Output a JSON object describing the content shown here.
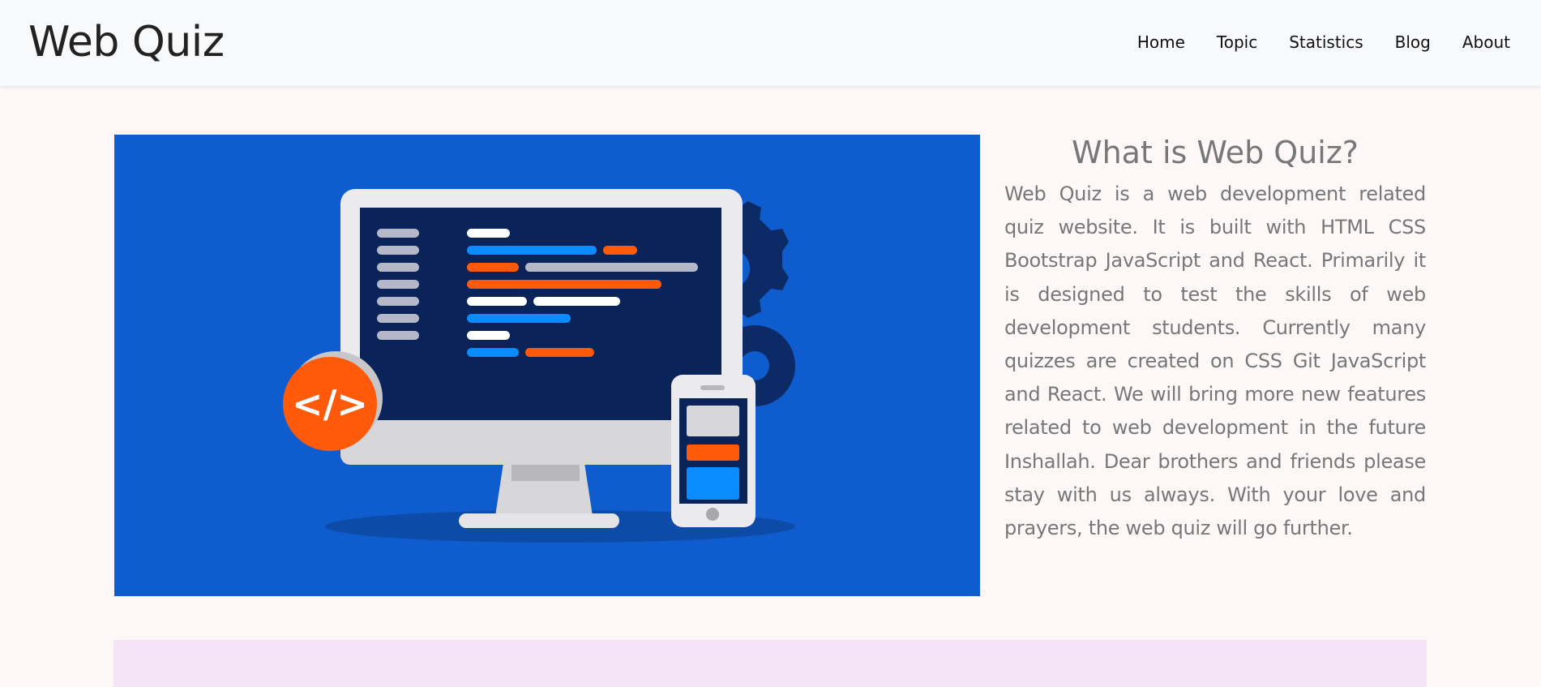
{
  "navbar": {
    "brand": "Web Quiz",
    "links": [
      {
        "label": "Home"
      },
      {
        "label": "Topic"
      },
      {
        "label": "Statistics"
      },
      {
        "label": "Blog"
      },
      {
        "label": "About"
      }
    ]
  },
  "hero": {
    "illustration": "web-development-monitor-illustration",
    "code_badge": "</>",
    "background_color": "#0f5cce"
  },
  "about": {
    "title": "What is Web Quiz?",
    "text": "Web Quiz is a web development related quiz website. It is built with HTML CSS Bootstrap JavaScript and React. Primarily it is designed to test the skills of web development students. Currently many quizzes are created on CSS Git JavaScript and React. We will bring more new features related to web development in the future Inshallah. Dear brothers and friends please stay with us always. With your love and prayers, the web quiz will go further."
  },
  "colors": {
    "accent_orange": "#ff5a0a",
    "accent_blue": "#0a8cff",
    "screen_navy": "#0a2459",
    "lower_section": "#f3e5f5"
  }
}
